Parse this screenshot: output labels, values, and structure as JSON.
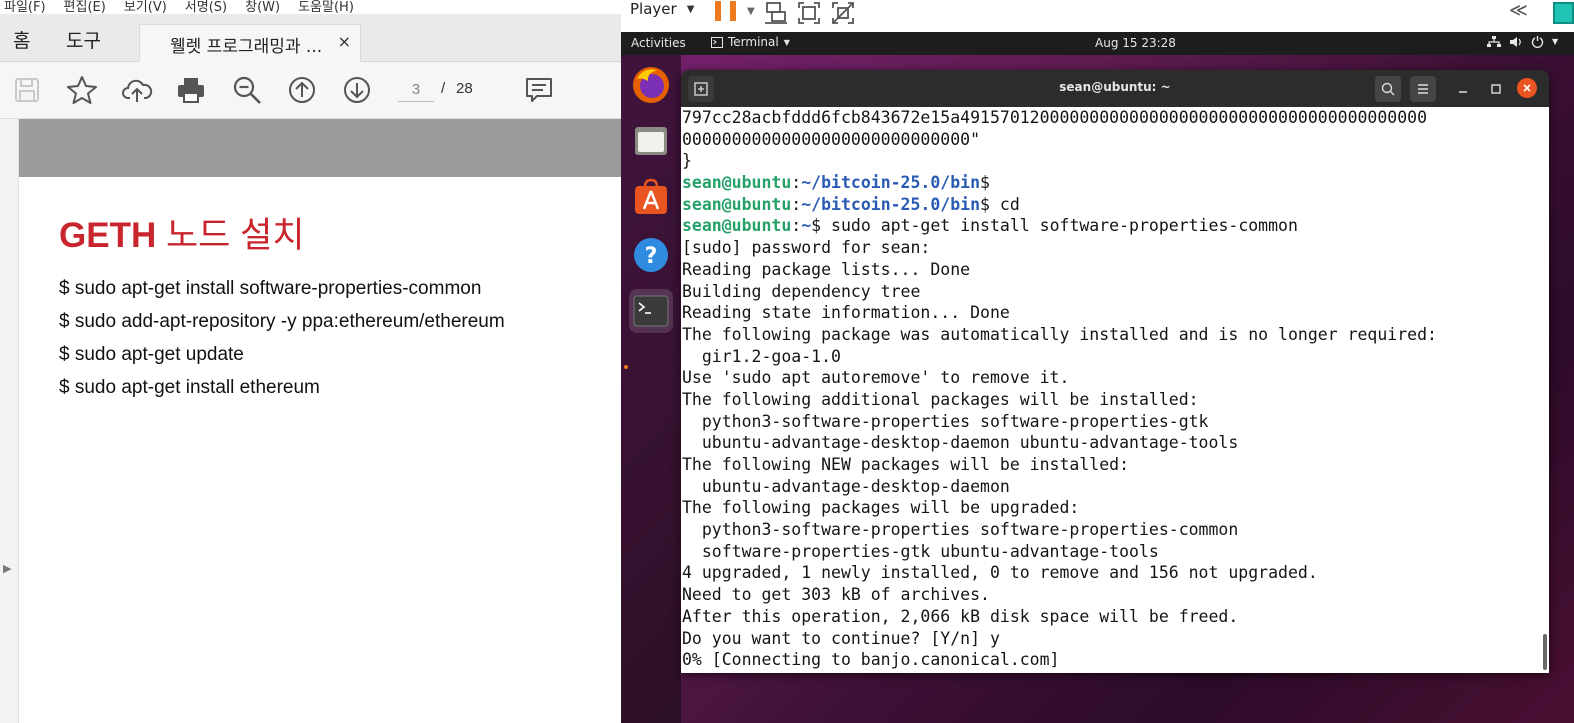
{
  "pdf_viewer": {
    "menubar": [
      "파일(F)",
      "편집(E)",
      "보기(V)",
      "서명(S)",
      "창(W)",
      "도움말(H)"
    ],
    "nav_tabs": [
      "홈",
      "도구"
    ],
    "doc_tab_title": "웰렛 프로그래밍과 ...",
    "doc_tab_close": "×",
    "toolbar_icons": [
      "save-icon",
      "star-icon",
      "cloud-upload-icon",
      "print-icon",
      "zoom-out-icon",
      "arrow-up-circle-icon",
      "arrow-down-circle-icon",
      "comment-icon"
    ],
    "current_page": "3",
    "page_separator": "/",
    "total_pages": "28",
    "slide": {
      "title_bold": "GETH",
      "title_rest": "노드 설치",
      "commands": [
        "$ sudo apt-get install software-properties-common",
        "$ sudo add-apt-repository -y ppa:ethereum/ethereum",
        "$ sudo apt-get update",
        "$ sudo apt-get install ethereum"
      ]
    }
  },
  "vm_player": {
    "player_menu": "Player",
    "accent_color": "#ef7a1e",
    "gnome_bar": {
      "activities": "Activities",
      "app_menu": "Terminal",
      "clock": "Aug 15  23:28",
      "tray_icons": [
        "network-icon",
        "volume-icon",
        "power-icon"
      ]
    },
    "dock": [
      "firefox-icon",
      "files-icon",
      "software-center-icon",
      "help-icon",
      "terminal-icon"
    ],
    "terminal": {
      "title": "sean@ubuntu: ~",
      "prompt_user": "sean@ubuntu",
      "lines": [
        {
          "text": "797cc28acbfddd6fcb843672e15a49157012000000000000000000000000000000000000000"
        },
        {
          "text": "00000000000000000000000000000\""
        },
        {
          "text": "}"
        },
        {
          "path": "~/bitcoin-25.0/bin",
          "cmd": ""
        },
        {
          "path": "~/bitcoin-25.0/bin",
          "cmd": " cd"
        },
        {
          "path": "~",
          "cmd": " sudo apt-get install software-properties-common"
        },
        {
          "text": "[sudo] password for sean:"
        },
        {
          "text": "Reading package lists... Done"
        },
        {
          "text": "Building dependency tree"
        },
        {
          "text": "Reading state information... Done"
        },
        {
          "text": "The following package was automatically installed and is no longer required:"
        },
        {
          "text": "  gir1.2-goa-1.0"
        },
        {
          "text": "Use 'sudo apt autoremove' to remove it."
        },
        {
          "text": "The following additional packages will be installed:"
        },
        {
          "text": "  python3-software-properties software-properties-gtk"
        },
        {
          "text": "  ubuntu-advantage-desktop-daemon ubuntu-advantage-tools"
        },
        {
          "text": "The following NEW packages will be installed:"
        },
        {
          "text": "  ubuntu-advantage-desktop-daemon"
        },
        {
          "text": "The following packages will be upgraded:"
        },
        {
          "text": "  python3-software-properties software-properties-common"
        },
        {
          "text": "  software-properties-gtk ubuntu-advantage-tools"
        },
        {
          "text": "4 upgraded, 1 newly installed, 0 to remove and 156 not upgraded."
        },
        {
          "text": "Need to get 303 kB of archives."
        },
        {
          "text": "After this operation, 2,066 kB disk space will be freed."
        },
        {
          "text": "Do you want to continue? [Y/n] y"
        },
        {
          "text": "0% [Connecting to banjo.canonical.com]"
        }
      ]
    }
  }
}
